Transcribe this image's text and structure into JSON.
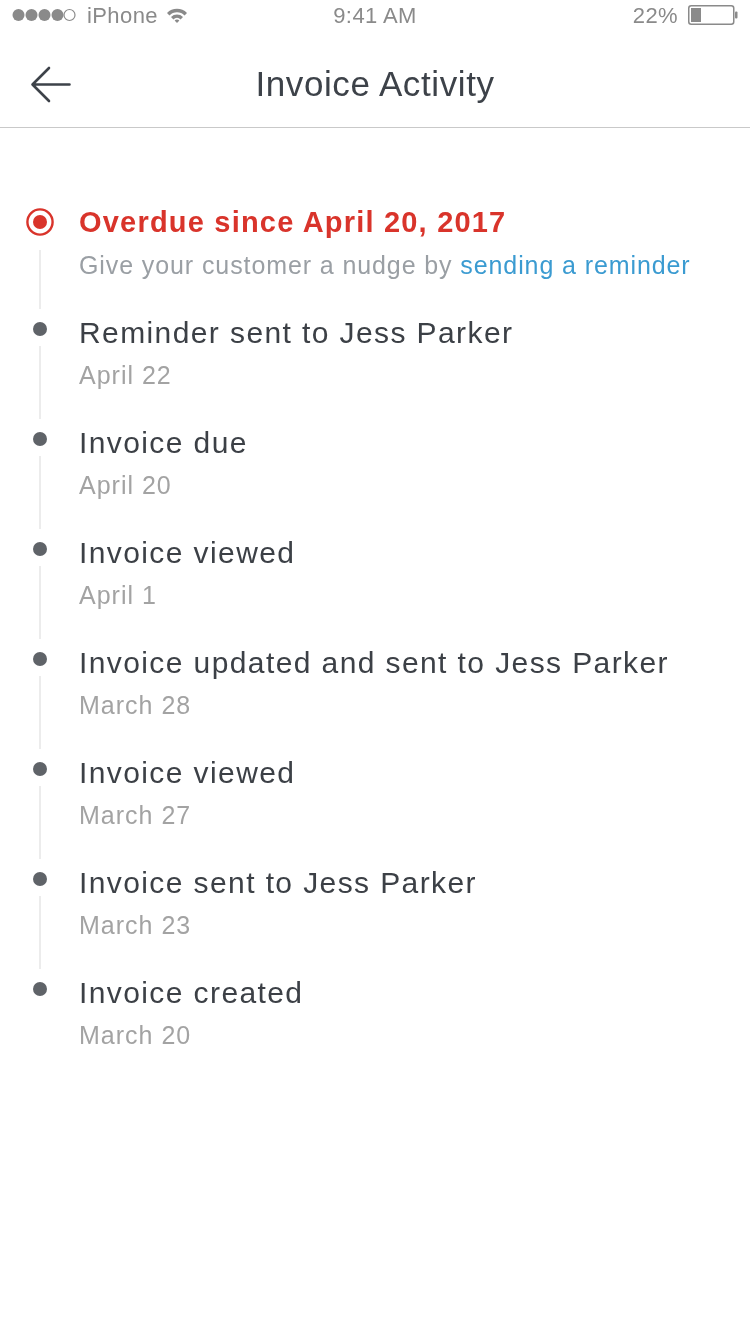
{
  "status_bar": {
    "carrier": "iPhone",
    "time": "9:41 AM",
    "battery": "22%"
  },
  "nav_bar": {
    "title": "Invoice Activity"
  },
  "timeline": [
    {
      "kind": "overdue",
      "title": "Overdue since April 20, 2017",
      "subtitle": "Give your customer a nudge by",
      "link": "sending a reminder"
    },
    {
      "kind": "event",
      "title": "Reminder sent to Jess Parker",
      "date": "April 22"
    },
    {
      "kind": "event",
      "title": "Invoice due",
      "date": "April 20"
    },
    {
      "kind": "event",
      "title": "Invoice viewed",
      "date": "April 1"
    },
    {
      "kind": "event",
      "title": "Invoice updated and sent to Jess Parker",
      "date": "March 28"
    },
    {
      "kind": "event",
      "title": "Invoice viewed",
      "date": "March 27"
    },
    {
      "kind": "event",
      "title": "Invoice sent to Jess Parker",
      "date": "March 23"
    },
    {
      "kind": "event",
      "title": "Invoice created",
      "date": "March 20"
    }
  ]
}
